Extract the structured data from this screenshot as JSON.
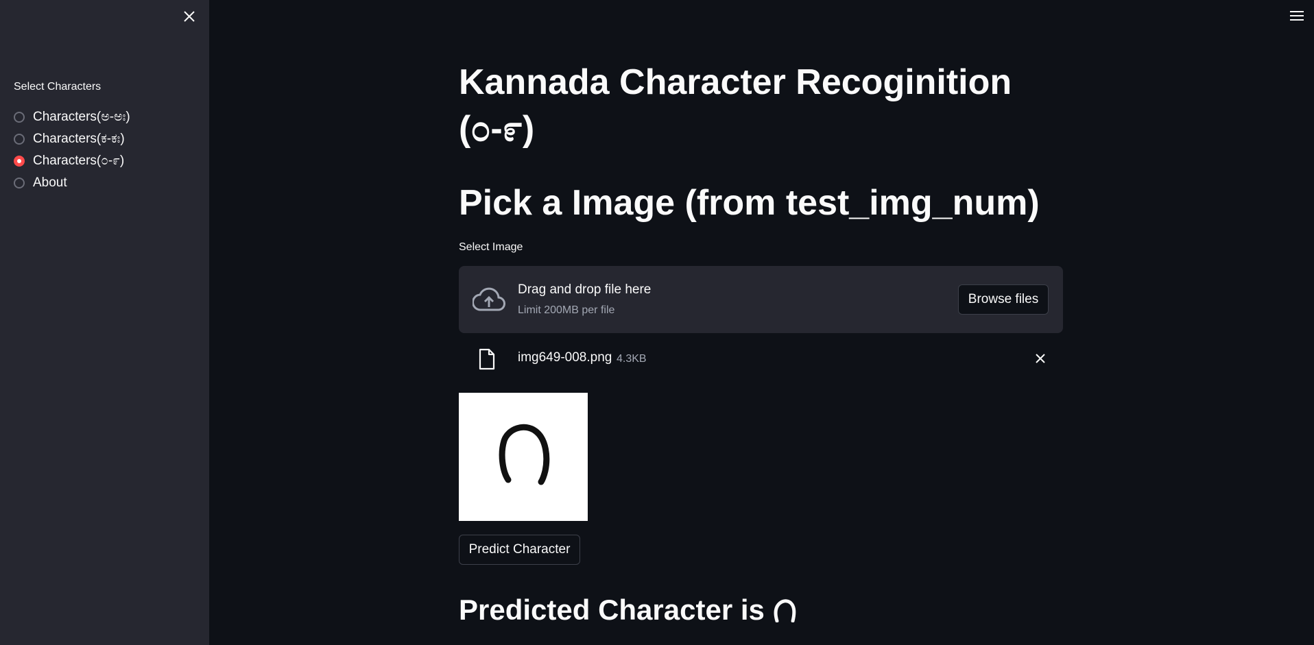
{
  "sidebar": {
    "section_label": "Select Characters",
    "options": [
      {
        "label": "Characters(ಅ-ಅಃ)",
        "selected": false
      },
      {
        "label": "Characters(ಕ-ಕಃ)",
        "selected": false
      },
      {
        "label": "Characters(೦-೯)",
        "selected": true
      },
      {
        "label": "About",
        "selected": false
      }
    ],
    "close_icon": "close-icon"
  },
  "header": {
    "menu_icon": "hamburger-menu-icon"
  },
  "main": {
    "title": "Kannada Character Recoginition (೦-೯)",
    "subtitle": "Pick a Image (from test_img_num)",
    "uploader": {
      "label": "Select Image",
      "drop_title": "Drag and drop file here",
      "drop_limit": "Limit 200MB per file",
      "browse_label": "Browse files",
      "icon": "cloud-upload-icon"
    },
    "uploaded_file": {
      "name": "img649-008.png",
      "size": "4.3KB",
      "icon": "file-icon",
      "remove_icon": "close-icon"
    },
    "predict_label": "Predict Character",
    "result_text": "Predicted Character is"
  },
  "colors": {
    "background": "#0e1117",
    "sidebar": "#262730",
    "accent": "#ff4b4b",
    "text": "#fafafa",
    "muted_text": "#a3a8b4"
  }
}
